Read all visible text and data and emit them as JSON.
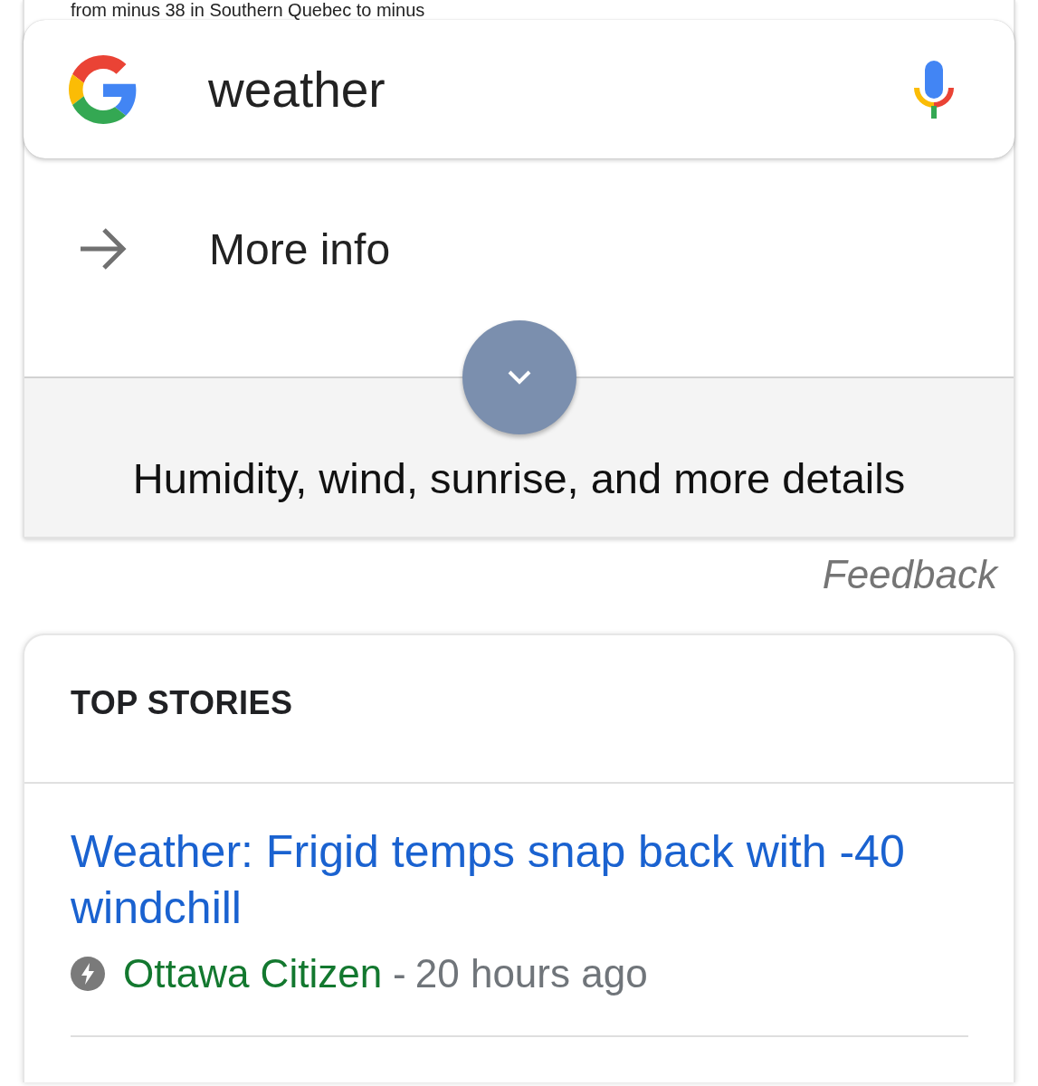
{
  "snippet": {
    "text": "from minus 38 in Southern Quebec to minus"
  },
  "search_bar": {
    "query": "weather"
  },
  "weather_card": {
    "more_info": "More info",
    "expand_button": {
      "expanded": false
    },
    "details_label": "Humidity, wind, sunrise, and more details"
  },
  "feedback": "Feedback",
  "top_stories": {
    "title": "TOP STORIES",
    "stories": [
      {
        "headline": "Weather: Frigid temps snap back with -40 windchill",
        "source": "Ottawa Citizen",
        "separator": "-",
        "time": "20 hours ago"
      }
    ]
  }
}
